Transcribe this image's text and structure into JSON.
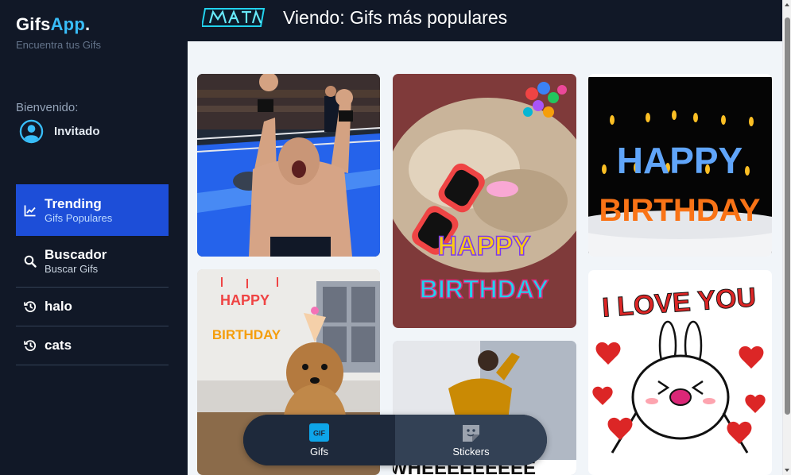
{
  "brand": {
    "part1": "Gifs",
    "part2": "App",
    "dot": "."
  },
  "tagline": "Encuentra tus Gifs",
  "welcome": "Bienvenido:",
  "user": {
    "name": "Invitado"
  },
  "nav": [
    {
      "label": "Trending",
      "sub": "Gifs Populares",
      "icon": "trending-icon",
      "active": true
    },
    {
      "label": "Buscador",
      "sub": "Buscar Gifs",
      "icon": "search-icon",
      "active": false
    },
    {
      "label": "halo",
      "icon": "history-icon",
      "active": false
    },
    {
      "label": "cats",
      "icon": "history-icon",
      "active": false
    }
  ],
  "header": {
    "title": "Viendo: Gifs más populares"
  },
  "gifs": [
    {
      "name": "wrestler-celebrating"
    },
    {
      "name": "dog-happy-birthday-glasses",
      "caption": [
        "HAPPY",
        "BIRTHDAY"
      ]
    },
    {
      "name": "happy-birthday-candles",
      "caption": [
        "HAPPY",
        "BIRTHDAY"
      ]
    },
    {
      "name": "dog-party-hat",
      "caption": [
        "HAPPY",
        "BIRTHDAY"
      ]
    },
    {
      "name": "woman-wall",
      "caption": [
        "WHEEEEEEEEE"
      ]
    },
    {
      "name": "bunny-i-love-you",
      "caption": [
        "I LOVE YOU"
      ]
    }
  ],
  "tabs": [
    {
      "label": "Gifs",
      "icon": "gif-icon",
      "badge": "GIF",
      "active": true
    },
    {
      "label": "Stickers",
      "icon": "sticker-icon",
      "active": false
    }
  ],
  "colors": {
    "sidebar": "#111827",
    "accent": "#1d4ed8",
    "brand_accent": "#38bdf8",
    "content_bg": "#f1f5f9"
  }
}
